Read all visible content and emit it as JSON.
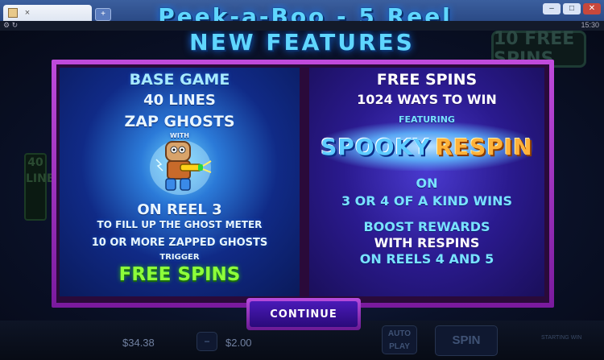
{
  "browser": {
    "tab_title": "Peek-a-Boo - 5 Reel",
    "tab_close": "×",
    "new_tab": "+",
    "clock": "15:30"
  },
  "game": {
    "title": "NEW FEATURES",
    "bg_badge": "10 FREE SPINS",
    "bg_lines": "40 LINES",
    "bottom": {
      "balance": "$34.38",
      "bet": "$2.00",
      "minus": "−",
      "auto_play": "AUTO PLAY",
      "spin": "SPIN",
      "start_hint": "STARTING WIN"
    },
    "left_panel": {
      "heading": "BASE GAME",
      "lines": "40 LINES",
      "zap": "ZAP GHOSTS",
      "with": "WITH",
      "reel": "ON REEL 3",
      "fill": "TO FILL UP THE GHOST METER",
      "zapped": "10 OR MORE ZAPPED GHOSTS",
      "trigger": "TRIGGER",
      "free_spins": "FREE SPINS"
    },
    "right_panel": {
      "heading": "FREE SPINS",
      "ways": "1024 WAYS TO WIN",
      "featuring": "FEATURING",
      "logo_part1": "SPOOKY",
      "logo_part2": "RESPIN",
      "on": "ON",
      "kind_wins": "3 OR 4 OF A KIND WINS",
      "boost": "BOOST REWARDS",
      "with_respins": "WITH RESPINS",
      "on_reels": "ON REELS 4 AND 5"
    },
    "continue_label": "CONTINUE"
  }
}
